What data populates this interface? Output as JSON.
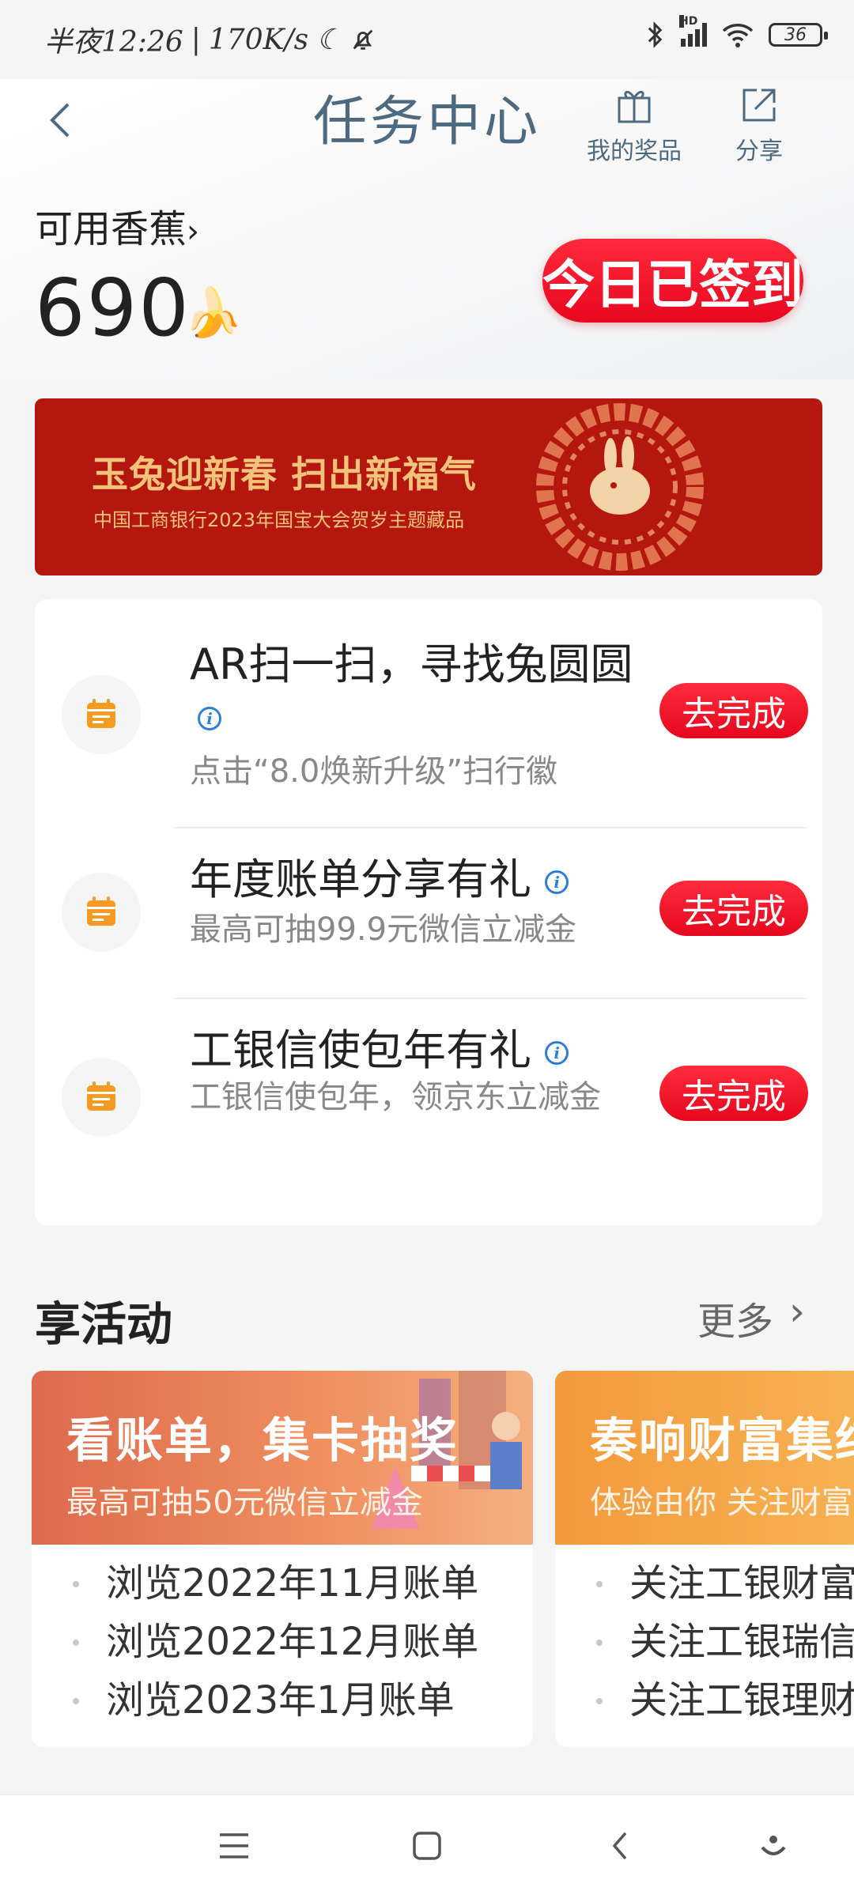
{
  "status_bar": {
    "time": "半夜12:26",
    "net_speed": "170K/s",
    "battery": "36"
  },
  "header": {
    "title": "任务中心",
    "prizes_label": "我的奖品",
    "share_label": "分享"
  },
  "balance": {
    "label": "可用香蕉",
    "value": "690",
    "checkin_label": "今日已签到"
  },
  "banner": {
    "title": "玉兔迎新春 扫出新福气",
    "subtitle": "中国工商银行2023年国宝大会贺岁主题藏品"
  },
  "tasks": [
    {
      "title": "AR扫一扫，寻找兔圆圆",
      "desc": "点击“8.0焕新升级”扫行徽",
      "button": "去完成"
    },
    {
      "title": "年度账单分享有礼",
      "desc": "最高可抽99.9元微信立减金",
      "button": "去完成"
    },
    {
      "title": "工银信使包年有礼",
      "desc": "工银信使包年，领京东立减金",
      "button": "去完成"
    }
  ],
  "activities": {
    "title": "享活动",
    "more": "更多",
    "cards": [
      {
        "title": "看账单，集卡抽奖",
        "subtitle": "最高可抽50元微信立减金",
        "items": [
          "浏览2022年11月账单",
          "浏览2022年12月账单",
          "浏览2023年1月账单"
        ]
      },
      {
        "title": "奏响财富集结",
        "subtitle": "体验由你 关注财富",
        "items": [
          "关注工银财富",
          "关注工银瑞信",
          "关注工银理财"
        ]
      }
    ]
  },
  "colors": {
    "accent_red": "#e8071f",
    "header_blue": "#4e6a80",
    "task_icon_orange": "#f59a23"
  }
}
